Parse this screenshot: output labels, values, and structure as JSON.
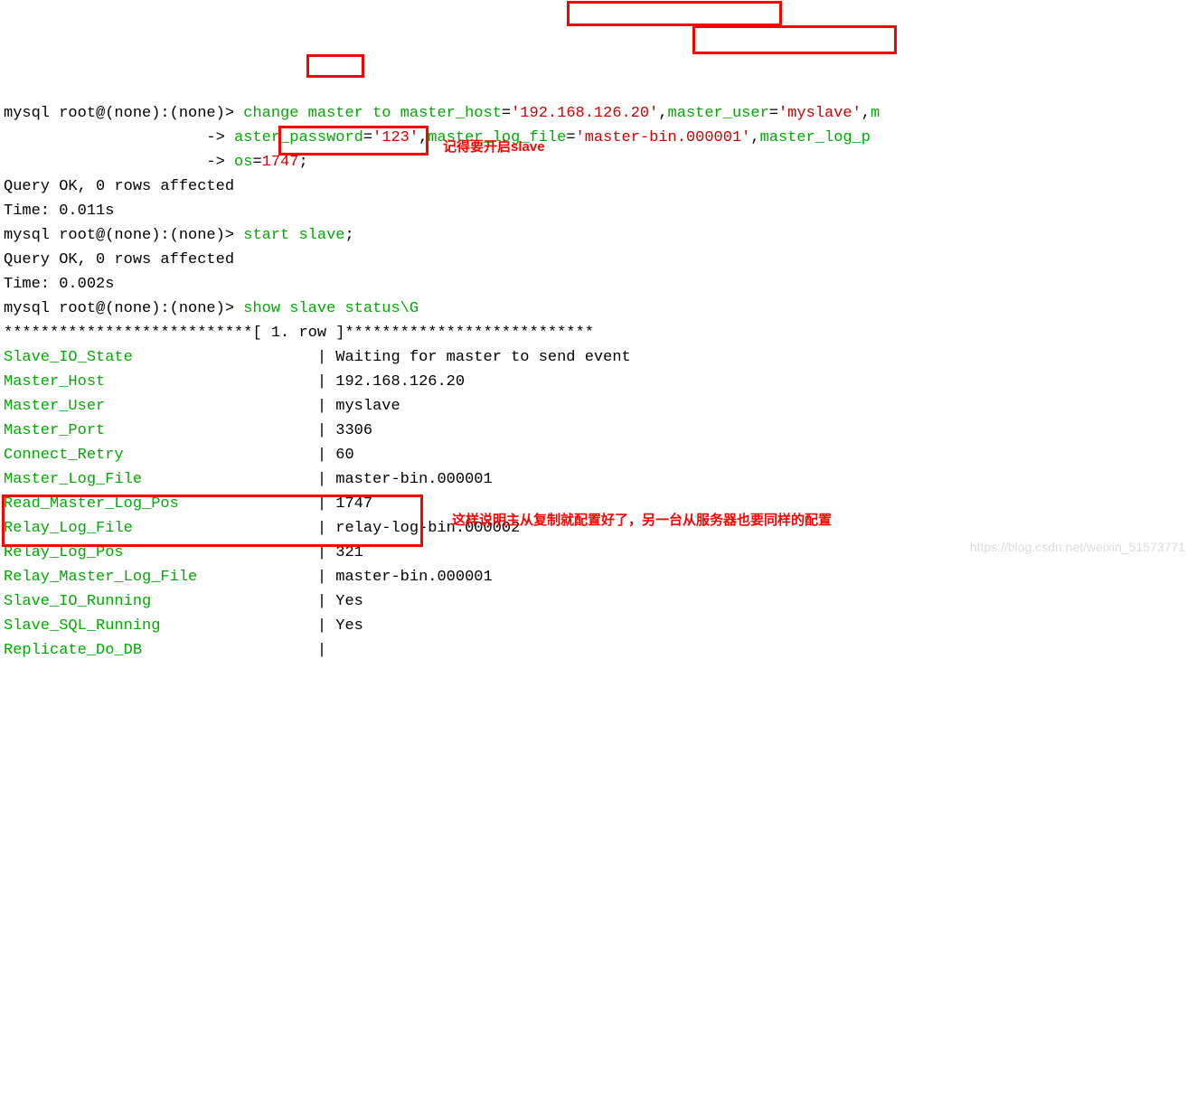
{
  "prompt": "mysql root@(none):(none)> ",
  "cont": "                      -> ",
  "cmd": {
    "l1a": "change master to master_host",
    "l1b": "=",
    "l1c": "'192.168.126.20'",
    "l1d": ",",
    "l1e": "master_user",
    "l1f": "=",
    "l1g": "'myslave'",
    "l1h": ",",
    "l1i": "m",
    "l2a": "aster_password",
    "l2b": "=",
    "l2c": "'123'",
    "l2d": ",",
    "l2e": "master_log_file",
    "l2f": "=",
    "l2g": "'master-bin.000001'",
    "l2h": ",",
    "l2i": "master_log_p",
    "l3a": "os",
    "l3b": "=",
    "l3c": "1747",
    "l3d": ";"
  },
  "out1_l1": "Query OK, 0 rows affected",
  "out1_l2": "Time: 0.011s",
  "cmd2": "start slave",
  "cmd2_semi": ";",
  "out2_l1": "Query OK, 0 rows affected",
  "out2_l2": "Time: 0.002s",
  "cmd3": "show slave status\\G",
  "rowsep": "***************************[ 1. row ]***************************",
  "rows": [
    {
      "k": "Slave_IO_State",
      "v": "Waiting for master to send event"
    },
    {
      "k": "Master_Host",
      "v": "192.168.126.20"
    },
    {
      "k": "Master_User",
      "v": "myslave"
    },
    {
      "k": "Master_Port",
      "v": "3306"
    },
    {
      "k": "Connect_Retry",
      "v": "60"
    },
    {
      "k": "Master_Log_File",
      "v": "master-bin.000001"
    },
    {
      "k": "Read_Master_Log_Pos",
      "v": "1747"
    },
    {
      "k": "Relay_Log_File",
      "v": "relay-log-bin.000002"
    },
    {
      "k": "Relay_Log_Pos",
      "v": "321"
    },
    {
      "k": "Relay_Master_Log_File",
      "v": "master-bin.000001"
    },
    {
      "k": "Slave_IO_Running",
      "v": "Yes"
    },
    {
      "k": "Slave_SQL_Running",
      "v": "Yes"
    },
    {
      "k": "Replicate_Do_DB",
      "v": ""
    }
  ],
  "anno1": "记得要开启slave",
  "anno2": "这样说明主从复制就配置好了，另一台从服务器也要同样的配置",
  "watermark": "https://blog.csdn.net/weixin_51573771"
}
